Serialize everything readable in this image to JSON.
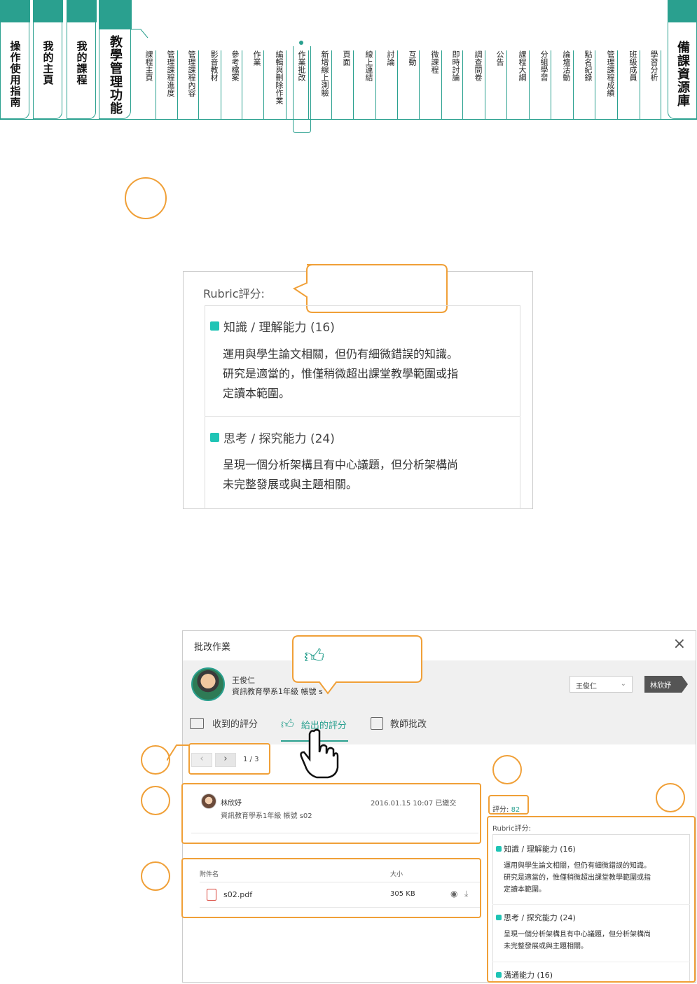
{
  "topnav": {
    "main_tabs": [
      "操作使用指南",
      "我的主頁",
      "我的課程",
      "教學管理功能"
    ],
    "sub_tabs": [
      "課程主頁",
      "管理課程進度",
      "管理課程內容",
      "影音教材",
      "參考檔案",
      "作業",
      "編輯與刪除作業",
      "作業批改",
      "新增線上測驗",
      "頁面",
      "線上連結",
      "討論",
      "互動",
      "微課程",
      "即時討論",
      "調查問卷",
      "公告",
      "課程大綱",
      "分組學習",
      "論壇活動",
      "點名紀錄",
      "管理課程成績",
      "班級成員",
      "學習分析"
    ],
    "active_sub": "作業批改",
    "right_tab": "備課資源庫"
  },
  "rubric_detail": {
    "title": "Rubric評分:",
    "criteria": [
      {
        "name": "知識 / 理解能力 (16)",
        "desc": [
          "運用與學生論文相關，但仍有細微錯誤的知識。",
          "研究是適當的，惟僅稍微超出課堂教學範圍或指",
          "定讀本範圍。"
        ]
      },
      {
        "name": "思考 / 探究能力 (24)",
        "desc": [
          "呈現一個分析架構且有中心議題，但分析架構尚",
          "未完整發展或與主題相關。"
        ]
      }
    ]
  },
  "modal": {
    "title": "批改作業",
    "close": "×",
    "student_name": "王俊仁",
    "student_info": "資訊教育學系1年級 帳號 s",
    "student_select": "王俊仁",
    "next_student": "林欣妤",
    "tabs": [
      "收到的評分",
      "給出的評分",
      "教師批改"
    ],
    "pager": "1 / 3",
    "reviewer": {
      "name": "林欣妤",
      "info": "資訊教育學系1年級 帳號 s02",
      "time": "2016.01.15 10:07 已繳交"
    },
    "attachments": {
      "col_name": "附件名",
      "col_size": "大小",
      "file": "s02.pdf",
      "size": "305 KB"
    },
    "score_label": "評分: ",
    "score_value": "82",
    "rubric_title": "Rubric評分:",
    "criteria": [
      {
        "name": "知識 / 理解能力 (16)",
        "desc": [
          "運用與學生論文相關，但仍有細微錯誤的知識。",
          "研究是適當的，惟僅稍微超出課堂教學範圍或指",
          "定讀本範圍。"
        ]
      },
      {
        "name": "思考 / 探究能力 (24)",
        "desc": [
          "呈現一個分析架構且有中心議題，但分析架構尚",
          "未完整發展或與主題相關。"
        ]
      },
      {
        "name": "溝通能力 (16)",
        "desc": []
      }
    ]
  },
  "colors": {
    "teal": "#2aa08f",
    "orange": "#f0a038",
    "accent": "#1fc4b5"
  }
}
